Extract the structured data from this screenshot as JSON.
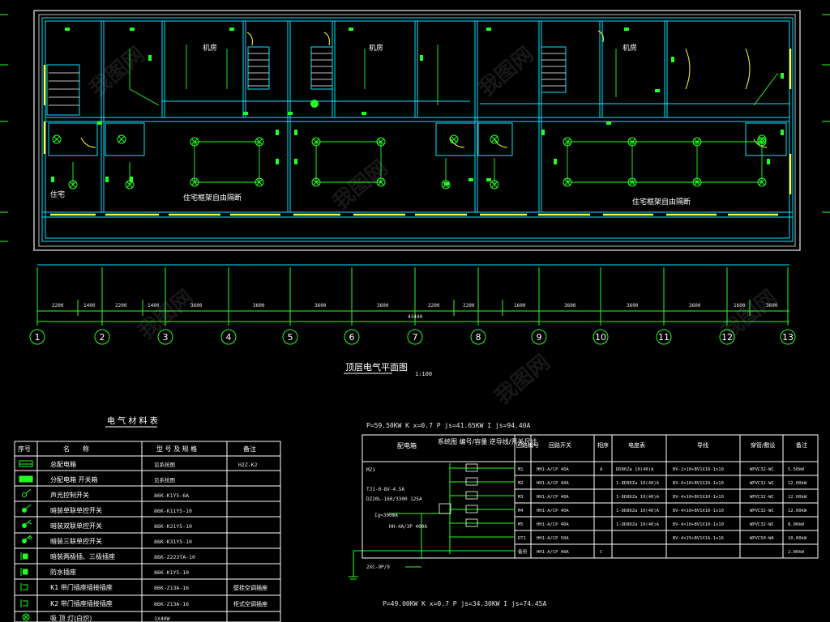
{
  "plan": {
    "rooms": {
      "machine_room_1": "机房",
      "machine_room_2": "机房",
      "machine_room_3": "机房",
      "residence": "住宅",
      "open_area_1": "住宅框架自由隔断",
      "open_area_2": "住宅框架自由隔断"
    },
    "dimensions": [
      "2200",
      "1400",
      "2200",
      "1400",
      "3600",
      "3600",
      "3600",
      "3600",
      "2200",
      "2200",
      "1600",
      "3600",
      "3600",
      "3600",
      "1600",
      "3600"
    ],
    "total_dimension": "43440",
    "axes": [
      "1",
      "2",
      "3",
      "4",
      "5",
      "6",
      "7",
      "8",
      "9",
      "10",
      "11",
      "12",
      "13"
    ],
    "title": "顶层电气平面图",
    "scale": "1:100"
  },
  "materials": {
    "title": "电 气 材 料 表",
    "headers": [
      "序号",
      "名　　称",
      "型 号 及 规 格",
      "备注"
    ],
    "rows": [
      {
        "name": "总配电箱",
        "model": "见系统图",
        "note": "H2Z-K2"
      },
      {
        "name": "分配电箱 开关箱",
        "model": "见系统图",
        "note": ""
      },
      {
        "name": "声光控制开关",
        "model": "86K-K1Y5-6A",
        "note": ""
      },
      {
        "name": "暗装单联单控开关",
        "model": "86K-K11Y5-10",
        "note": ""
      },
      {
        "name": "暗装双联单控开关",
        "model": "86K-K21Y5-10",
        "note": ""
      },
      {
        "name": "暗装三联单控开关",
        "model": "86K-K31Y5-10",
        "note": ""
      },
      {
        "name": "暗装两极插、三极插座",
        "model": "86K-Z223TA-10",
        "note": ""
      },
      {
        "name": "防水插座",
        "model": "86K-K1Y5-10",
        "note": ""
      },
      {
        "name": "K1 带门插座插接插座",
        "model": "86K-Z13A-16",
        "note": "壁挂空调插座"
      },
      {
        "name": "K2 带门插座插接插座",
        "model": "86K-Z13A-16",
        "note": "柜式空调插座"
      },
      {
        "name": "吸 顶 灯(白炽)",
        "model": "1X40W",
        "note": ""
      }
    ]
  },
  "system": {
    "formula_top": "P=59.50KW  K   x=0.7  P  js=41.65KW  I  js=94.40A",
    "formula_bottom": "P=49.00KW  K   x=0.7  P  js=34.30KW  I  js=74.45A",
    "panel_id": "MZ1",
    "left_labels": [
      "TJ1-0-8V-4.5A",
      "DZ20L-160/3300 125A",
      "Ig=300mA",
      "HH-4A/3P 400A"
    ],
    "ground_label": "2XC-9P/9",
    "box_label": "配电箱",
    "system_label": "系统图 编号/容量\n逆导线/开关尺寸",
    "headers": [
      "回路编号",
      "回路开关",
      "相序",
      "电度表",
      "导线",
      "穿管/敷设",
      "备注"
    ],
    "rows": [
      {
        "id": "M1",
        "breaker": "HH1-A/CP 40A",
        "phase": "A",
        "meter": "DD86Za 10(40)A",
        "wire": "BV-2×10+BV1X10-1x10",
        "conduit": "WPVC32-WC",
        "note": "5.50kW"
      },
      {
        "id": "M2",
        "breaker": "HH1-A/CP 40A",
        "phase": "",
        "meter": "1-DD86Za 10(40)A",
        "wire": "BV-4×10+BV1X10-1x10",
        "conduit": "WPVC32-WC",
        "note": "12.00kW"
      },
      {
        "id": "M3",
        "breaker": "HH1-A/CP 40A",
        "phase": "",
        "meter": "1-DD86Za 10(40)A",
        "wire": "BV-4×10+BV1X10-1x10",
        "conduit": "WPVC32-WC",
        "note": "12.00kW"
      },
      {
        "id": "M4",
        "breaker": "HH1-A/CP 40A",
        "phase": "",
        "meter": "1-DD86Za 10(40)A",
        "wire": "BV-4×10+BV1X10-1x10",
        "conduit": "WPVC32-WC",
        "note": "12.00kW"
      },
      {
        "id": "M5",
        "breaker": "HH1-A/CP 40A",
        "phase": "",
        "meter": "1-DD86Za 10(40)A",
        "wire": "BV-4×10+BV1X10-1x10",
        "conduit": "WPVC32-WC",
        "note": "8.00kW"
      },
      {
        "id": "DT1",
        "breaker": "HH1-A/CP 50A",
        "phase": "",
        "meter": "",
        "wire": "BV-4×25+BV1X16-1x16",
        "conduit": "WPVC50-WA",
        "note": "10.00kW"
      },
      {
        "id": "备用",
        "breaker": "HH1-A/CP 40A",
        "phase": "C",
        "meter": "",
        "wire": "",
        "conduit": "",
        "note": "2.00kW"
      }
    ]
  },
  "watermark": "我图网"
}
